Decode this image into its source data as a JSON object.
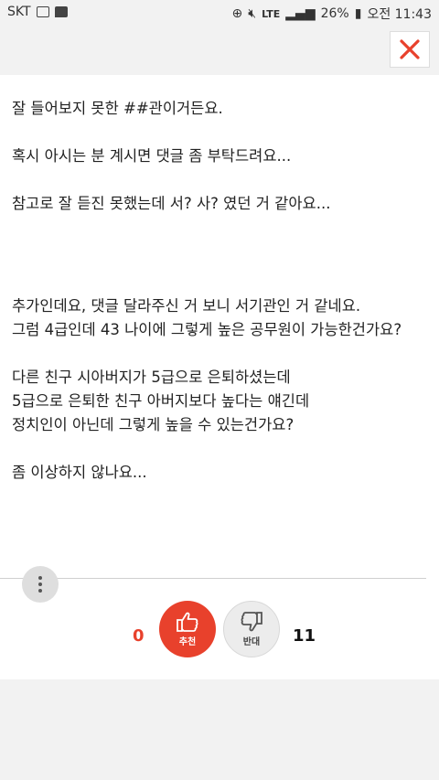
{
  "status_bar": {
    "carrier": "SKT",
    "lte": "LTE",
    "battery": "26%",
    "time": "오전 11:43"
  },
  "post": {
    "lines": [
      "잘 들어보지 못한 ##관이거든요.",
      "혹시 아시는 분 계시면 댓글 좀 부탁드려요...",
      "참고로 잘 듣진 못했는데 서? 사? 였던 거 같아요...",
      "추가인데요, 댓글 달라주신 거 보니 서기관인 거 같네요.",
      "그럼 4급인데 43 나이에 그렇게 높은 공무원이 가능한건가요?",
      "다른 친구 시아버지가 5급으로 은퇴하셨는데",
      "5급으로 은퇴한 친구 아버지보다 높다는 얘긴데",
      "정치인이 아닌데 그렇게 높을 수 있는건가요?",
      "좀 이상하지 않나요..."
    ]
  },
  "votes": {
    "up_count": "0",
    "up_label": "추천",
    "down_count": "11",
    "down_label": "반대"
  },
  "colors": {
    "accent": "#e8412c",
    "background": "#f2f2f2"
  }
}
